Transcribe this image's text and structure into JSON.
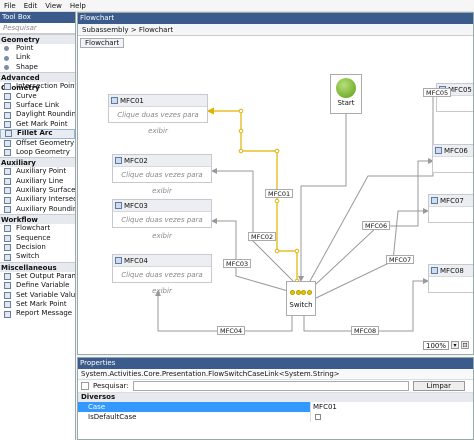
{
  "menu": [
    "File",
    "Edit",
    "View",
    "Help"
  ],
  "toolbox": {
    "title": "Tool Box",
    "search_placeholder": "Pesquisar",
    "categories": [
      {
        "name": "Geometry",
        "items": [
          "Point",
          "Link",
          "Shape"
        ]
      },
      {
        "name": "Advanced Geometry",
        "items": [
          "Intersection Point",
          "Curve",
          "Surface Link",
          "Daylight Rounding",
          "Get Mark Point",
          "Fillet Arc",
          "Offset Geometry",
          "Loop Geometry"
        ]
      },
      {
        "name": "Auxiliary",
        "items": [
          "Auxiliary Point",
          "Auxiliary Line",
          "Auxiliary Surface Link",
          "Auxiliary Intersection",
          "Auxiliary Rounding"
        ]
      },
      {
        "name": "Workflow",
        "items": [
          "Flowchart",
          "Sequence",
          "Decision",
          "Switch"
        ]
      },
      {
        "name": "Miscellaneous",
        "items": [
          "Set Output Parameter",
          "Define Variable",
          "Set Variable Value",
          "Set Mark Point",
          "Report Message"
        ]
      }
    ],
    "selected": "Fillet Arc"
  },
  "designer": {
    "title": "Flowchart",
    "breadcrumb": [
      "Subassembly",
      "Flowchart"
    ],
    "flowchart_header": "Flowchart",
    "start_label": "Start",
    "switch_label": "Switch",
    "node_hint": "Clique duas vezes para exibir",
    "nodes": [
      "MFC01",
      "MFC02",
      "MFC03",
      "MFC04",
      "MFC05",
      "MFC06",
      "MFC07",
      "MFC08"
    ],
    "link_labels": [
      "MFC01",
      "MFC02",
      "MFC03",
      "MFC04",
      "MFC05",
      "MFC06",
      "MFC07",
      "MFC08"
    ],
    "zoom": "100%"
  },
  "properties": {
    "title": "Properties",
    "type_name": "System.Activities.Core.Presentation.FlowSwitchCaseLink<System.String>",
    "search_label": "Pesquisar:",
    "clear_button": "Limpar",
    "category": "Diversos",
    "rows": [
      {
        "key": "Case",
        "value": "MFC01"
      },
      {
        "key": "IsDefaultCase",
        "value": ""
      }
    ]
  },
  "colors": {
    "title_bar": "#3b5b8c",
    "highlight_link": "#e2b200",
    "selection": "#3399ff"
  }
}
